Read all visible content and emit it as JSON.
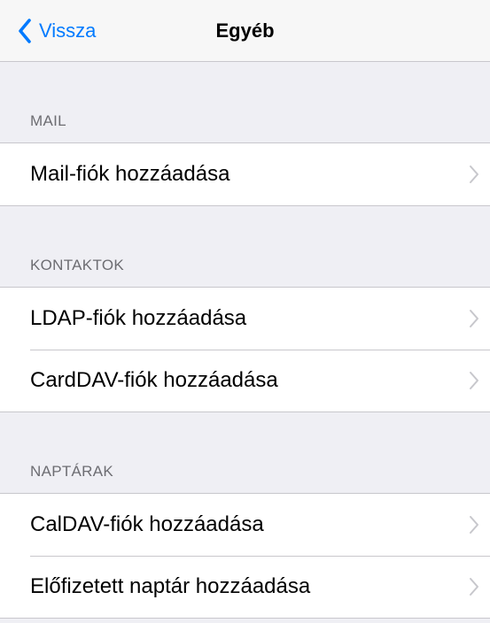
{
  "navbar": {
    "back_label": "Vissza",
    "title": "Egyéb"
  },
  "sections": [
    {
      "header": "MAIL",
      "rows": [
        "Mail-fiók hozzáadása"
      ]
    },
    {
      "header": "KONTAKTOK",
      "rows": [
        "LDAP-fiók hozzáadása",
        "CardDAV-fiók hozzáadása"
      ]
    },
    {
      "header": "NAPTÁRAK",
      "rows": [
        "CalDAV-fiók hozzáadása",
        "Előfizetett naptár hozzáadása"
      ]
    }
  ],
  "colors": {
    "accent": "#007aff",
    "background": "#efeff4",
    "separator": "#c8c7cc",
    "header_text": "#6d6d72",
    "chevron": "#c7c7cc"
  }
}
